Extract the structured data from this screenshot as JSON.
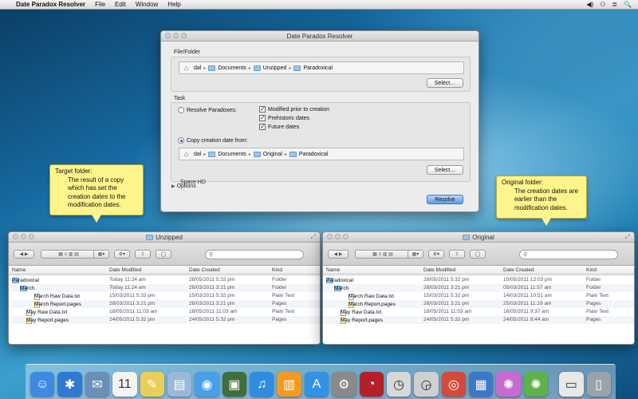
{
  "menubar": {
    "apple": "",
    "app_name": "Date Paradox Resolver",
    "menus": [
      "File",
      "Edit",
      "Window",
      "Help"
    ],
    "status": [
      "◀)",
      "⚇",
      "≣",
      "🔍"
    ]
  },
  "dialog": {
    "title": "Date Paradox Resolver",
    "file_folder_label": "File/Folder",
    "path1": [
      "dal",
      "Documents",
      "Unzipped",
      "Paradoxical"
    ],
    "select_label": "Select…",
    "task_label": "Task",
    "resolve_radio": "Resolve Paradoxes:",
    "checks": [
      "Modified prior to creation",
      "Prehistoric dates",
      "Future dates"
    ],
    "copy_radio": "Copy creation date from:",
    "path2": [
      "dal",
      "Documents",
      "Original",
      "Paradoxical"
    ],
    "select2_label": "Select…",
    "overlap_text": "Space HD",
    "options_label": "Options",
    "resolve_button": "Resolve"
  },
  "callouts": {
    "target": {
      "title": "Target folder:",
      "body": "The result of a copy which has set the creation dates to the modification dates."
    },
    "original": {
      "title": "Original folder:",
      "body": "The creation dates are earlier than the modification dates."
    }
  },
  "columns": [
    "Name",
    "Date Modified",
    "Date Created",
    "Kind"
  ],
  "unzipped": {
    "title": "Unzipped",
    "rows": [
      {
        "name": "Paradoxical",
        "modified": "Today 11:24 am",
        "created": "28/05/2011 5:32 pm",
        "kind": "Folder"
      },
      {
        "name": "March",
        "modified": "Today 11:24 am",
        "created": "28/03/2011 3:21 pm",
        "kind": "Folder"
      },
      {
        "name": "March Raw Data.txt",
        "modified": "15/03/2011 5:32 pm",
        "created": "15/03/2011 5:32 pm",
        "kind": "Plain Text"
      },
      {
        "name": "March Report.pages",
        "modified": "28/03/2011 3:21 pm",
        "created": "28/03/2011 3:21 pm",
        "kind": "Pages"
      },
      {
        "name": "May Raw Data.txt",
        "modified": "18/05/2011 11:03 am",
        "created": "18/05/2011 11:03 am",
        "kind": "Plain Text"
      },
      {
        "name": "May Report.pages",
        "modified": "24/05/2011 5:32 pm",
        "created": "24/05/2011 5:32 pm",
        "kind": "Pages"
      }
    ]
  },
  "original": {
    "title": "Original",
    "rows": [
      {
        "name": "Paradoxical",
        "modified": "28/05/2011 5:32 pm",
        "created": "10/05/2011 12:03 pm",
        "kind": "Folder"
      },
      {
        "name": "March",
        "modified": "28/03/2011 3:21 pm",
        "created": "05/03/2011 11:57 am",
        "kind": "Folder"
      },
      {
        "name": "March Raw Data.txt",
        "modified": "15/03/2011 5:32 pm",
        "created": "14/03/2011 10:51 am",
        "kind": "Plain Text"
      },
      {
        "name": "March Report.pages",
        "modified": "28/03/2011 3:21 pm",
        "created": "25/03/2011 11:19 am",
        "kind": "Pages"
      },
      {
        "name": "May Raw Data.txt",
        "modified": "18/05/2011 11:03 am",
        "created": "16/05/2011 9:37 am",
        "kind": "Plain Text"
      },
      {
        "name": "May Report.pages",
        "modified": "24/05/2011 5:32 pm",
        "created": "24/05/2011 8:44 am",
        "kind": "Pages"
      }
    ]
  },
  "dock": {
    "items": [
      {
        "icon": "finder-icon",
        "glyph": "☺",
        "color": "#3d8be0"
      },
      {
        "icon": "safari-icon",
        "glyph": "✱",
        "color": "#2f7ad0"
      },
      {
        "icon": "mail-icon",
        "glyph": "✉",
        "color": "#6b8fb5"
      },
      {
        "icon": "calendar-icon",
        "glyph": "11",
        "color": "#f4f4f4"
      },
      {
        "icon": "notes-icon",
        "glyph": "✎",
        "color": "#e9cf5a"
      },
      {
        "icon": "preview-icon",
        "glyph": "▤",
        "color": "#9bb8d8"
      },
      {
        "icon": "messages-icon",
        "glyph": "◉",
        "color": "#4aa0e8"
      },
      {
        "icon": "photo-icon",
        "glyph": "▣",
        "color": "#3f6f3a"
      },
      {
        "icon": "itunes-icon",
        "glyph": "♫",
        "color": "#2f8ce0"
      },
      {
        "icon": "ibooks-icon",
        "glyph": "▥",
        "color": "#f29a22"
      },
      {
        "icon": "appstore-icon",
        "glyph": "A",
        "color": "#3391e6"
      },
      {
        "icon": "settings-icon",
        "glyph": "⚙",
        "color": "#8a8a8a"
      },
      {
        "icon": "app-red-icon",
        "glyph": "◔",
        "color": "#b3202a"
      },
      {
        "icon": "app-clock-icon",
        "glyph": "◷",
        "color": "#d8d8d8"
      },
      {
        "icon": "app-clock2-icon",
        "glyph": "◶",
        "color": "#cfcfcf"
      },
      {
        "icon": "app-lifebuoy-icon",
        "glyph": "◎",
        "color": "#d24a3a"
      },
      {
        "icon": "app-calendar2-icon",
        "glyph": "▦",
        "color": "#3c78c8"
      },
      {
        "icon": "app-swirl-icon",
        "glyph": "✺",
        "color": "#c86bd0"
      },
      {
        "icon": "app-swirl2-icon",
        "glyph": "✺",
        "color": "#5db24a"
      },
      {
        "icon": "documents-icon",
        "glyph": "▭",
        "color": "#e8e8e8"
      },
      {
        "icon": "trash-icon",
        "glyph": "▯",
        "color": "#9aa3ab"
      }
    ]
  }
}
